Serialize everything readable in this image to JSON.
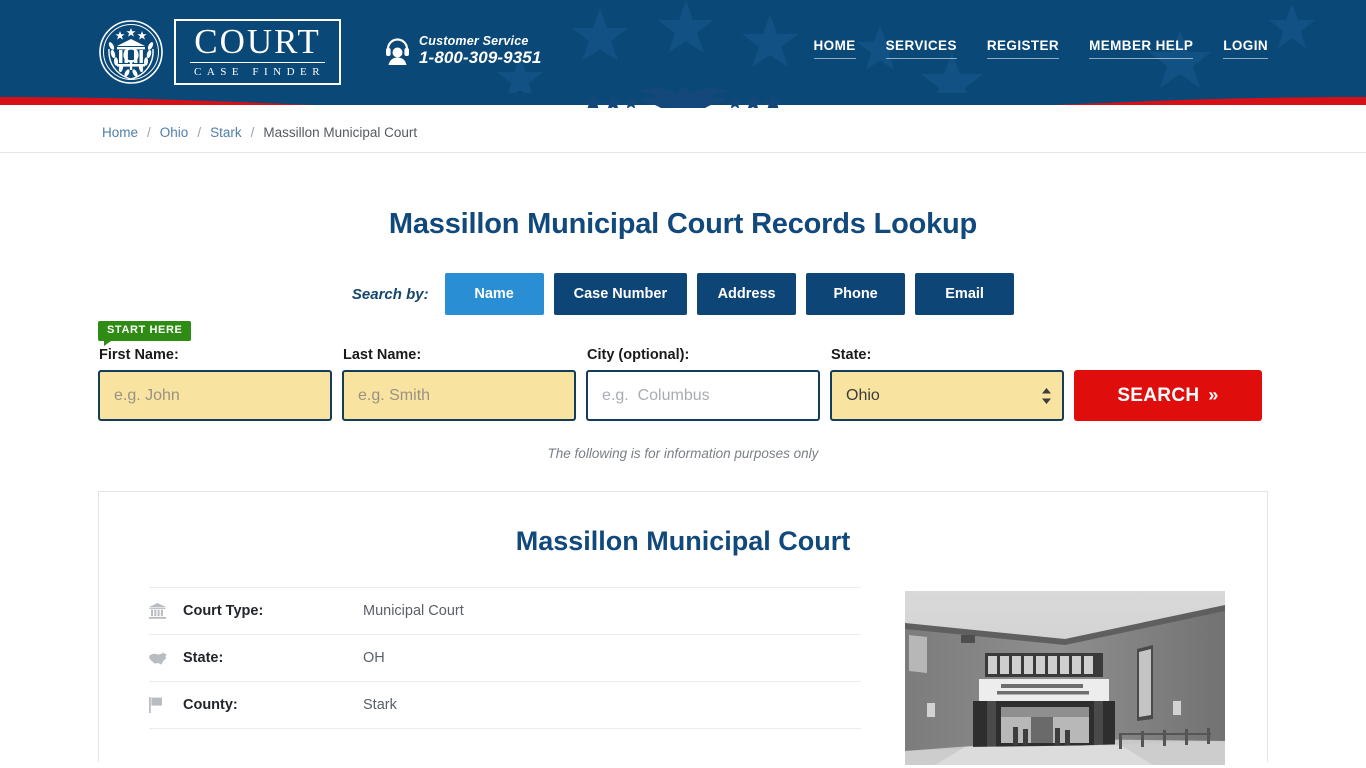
{
  "header": {
    "logo": {
      "seal_icon": "court-seal-icon",
      "word_main": "COURT",
      "word_sub": "CASE FINDER"
    },
    "customer_service": {
      "icon": "headset-support-icon",
      "label": "Customer Service",
      "phone": "1-800-309-9351"
    },
    "nav": [
      {
        "label": "HOME"
      },
      {
        "label": "SERVICES"
      },
      {
        "label": "REGISTER"
      },
      {
        "label": "MEMBER HELP"
      },
      {
        "label": "LOGIN"
      }
    ],
    "colors": {
      "navy": "#0a4878",
      "red": "#d61016",
      "bright_blue": "#2a8ed4"
    }
  },
  "breadcrumb": {
    "items": [
      {
        "label": "Home",
        "current": false
      },
      {
        "label": "Ohio",
        "current": false
      },
      {
        "label": "Stark",
        "current": false
      },
      {
        "label": "Massillon Municipal Court",
        "current": true
      }
    ],
    "separator": "/"
  },
  "main": {
    "page_title": "Massillon Municipal Court Records Lookup",
    "search_by_label": "Search by:",
    "tabs": [
      {
        "label": "Name",
        "active": true
      },
      {
        "label": "Case Number",
        "active": false
      },
      {
        "label": "Address",
        "active": false
      },
      {
        "label": "Phone",
        "active": false
      },
      {
        "label": "Email",
        "active": false
      }
    ],
    "start_badge": "START HERE",
    "form": {
      "first_name": {
        "label": "First Name:",
        "placeholder": "e.g. John",
        "value": ""
      },
      "last_name": {
        "label": "Last Name:",
        "placeholder": "e.g. Smith",
        "value": ""
      },
      "city": {
        "label": "City (optional):",
        "placeholder": "e.g.  Columbus",
        "value": ""
      },
      "state": {
        "label": "State:",
        "value": "Ohio",
        "options": [
          "Ohio"
        ]
      },
      "search_button": "SEARCH",
      "search_button_chevron": "»"
    },
    "info_note": "The following is for information purposes only"
  },
  "court_card": {
    "name": "Massillon Municipal Court",
    "rows": [
      {
        "icon": "bank-building-icon",
        "label": "Court Type:",
        "value": "Municipal Court"
      },
      {
        "icon": "us-map-icon",
        "label": "State:",
        "value": "OH"
      },
      {
        "icon": "flag-icon",
        "label": "County:",
        "value": "Stark"
      }
    ],
    "photo_alt": "courthouse-building-photo"
  }
}
